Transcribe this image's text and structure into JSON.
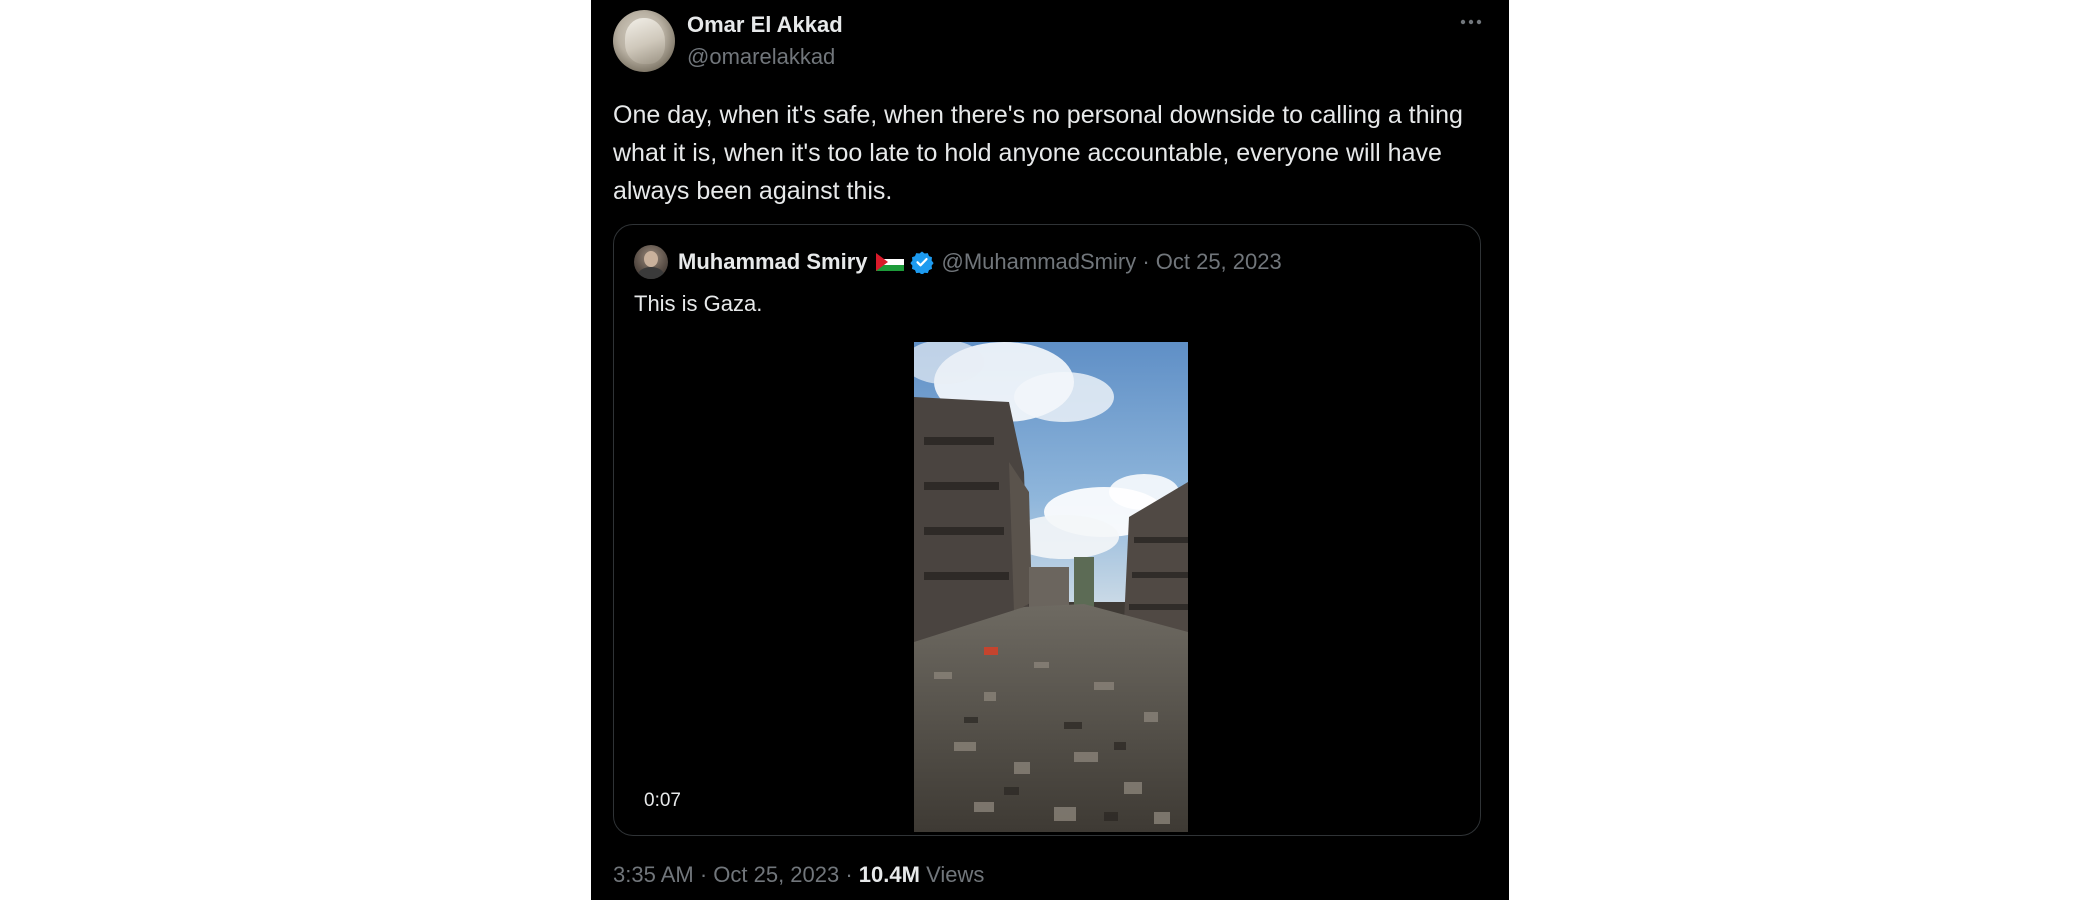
{
  "tweet": {
    "author_name": "Omar El Akkad",
    "author_handle": "@omarelakkad",
    "more_icon": "more-horizontal-icon",
    "text": "One day, when it's safe, when there's no personal downside to calling a thing what it is, when it's too late to hold anyone accountable, everyone will have always been against this.",
    "quoted": {
      "author_name": "Muhammad Smiry",
      "flag_icon": "palestine-flag-icon",
      "verified_icon": "verified-badge-icon",
      "verified_color": "#1d9bf0",
      "handle_and_date": "@MuhammadSmiry · Oct 25, 2023",
      "text": "This is Gaza.",
      "video_duration": "0:07"
    },
    "footer": {
      "time_date": "3:35 AM · Oct 25, 2023 · ",
      "views_count": "10.4M",
      "views_label": " Views"
    }
  },
  "colors": {
    "background": "#000000",
    "primary_text": "#e7e9ea",
    "secondary_text": "#71767b",
    "border": "#2f3336"
  }
}
